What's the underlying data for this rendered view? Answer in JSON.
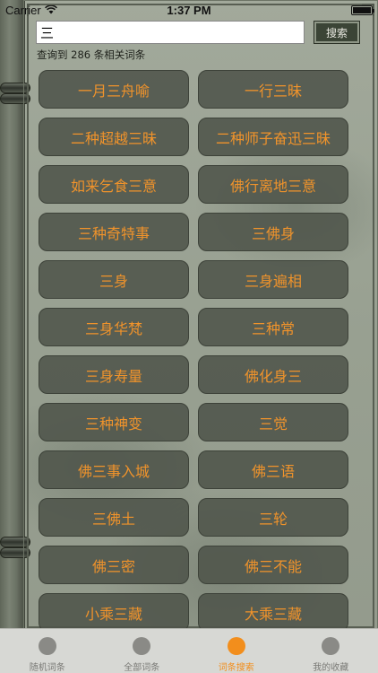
{
  "status_bar": {
    "carrier": "Carrier",
    "time": "1:37 PM"
  },
  "search": {
    "value": "三",
    "placeholder": "",
    "button_label": "搜索"
  },
  "result_count": "查询到 286 条相关词条",
  "terms": [
    "一月三舟喻",
    "一行三昧",
    "二种超越三昧",
    "二种师子奋迅三昧",
    "如来乞食三意",
    "佛行离地三意",
    "三种奇特事",
    "三佛身",
    "三身",
    "三身遍相",
    "三身华梵",
    "三种常",
    "三身寿量",
    "佛化身三",
    "三种神变",
    "三觉",
    "佛三事入城",
    "佛三语",
    "三佛土",
    "三轮",
    "佛三密",
    "佛三不能",
    "小乘三藏",
    "大乘三藏"
  ],
  "tabs": [
    {
      "label": "随机词条",
      "icon": "random-icon",
      "active": false
    },
    {
      "label": "全部词条",
      "icon": "list-icon",
      "active": false
    },
    {
      "label": "词条搜索",
      "icon": "search-icon",
      "active": true
    },
    {
      "label": "我的收藏",
      "icon": "favorite-icon",
      "active": false
    }
  ],
  "colors": {
    "term_text": "#f0932b",
    "active_tab": "#f28e1c"
  }
}
